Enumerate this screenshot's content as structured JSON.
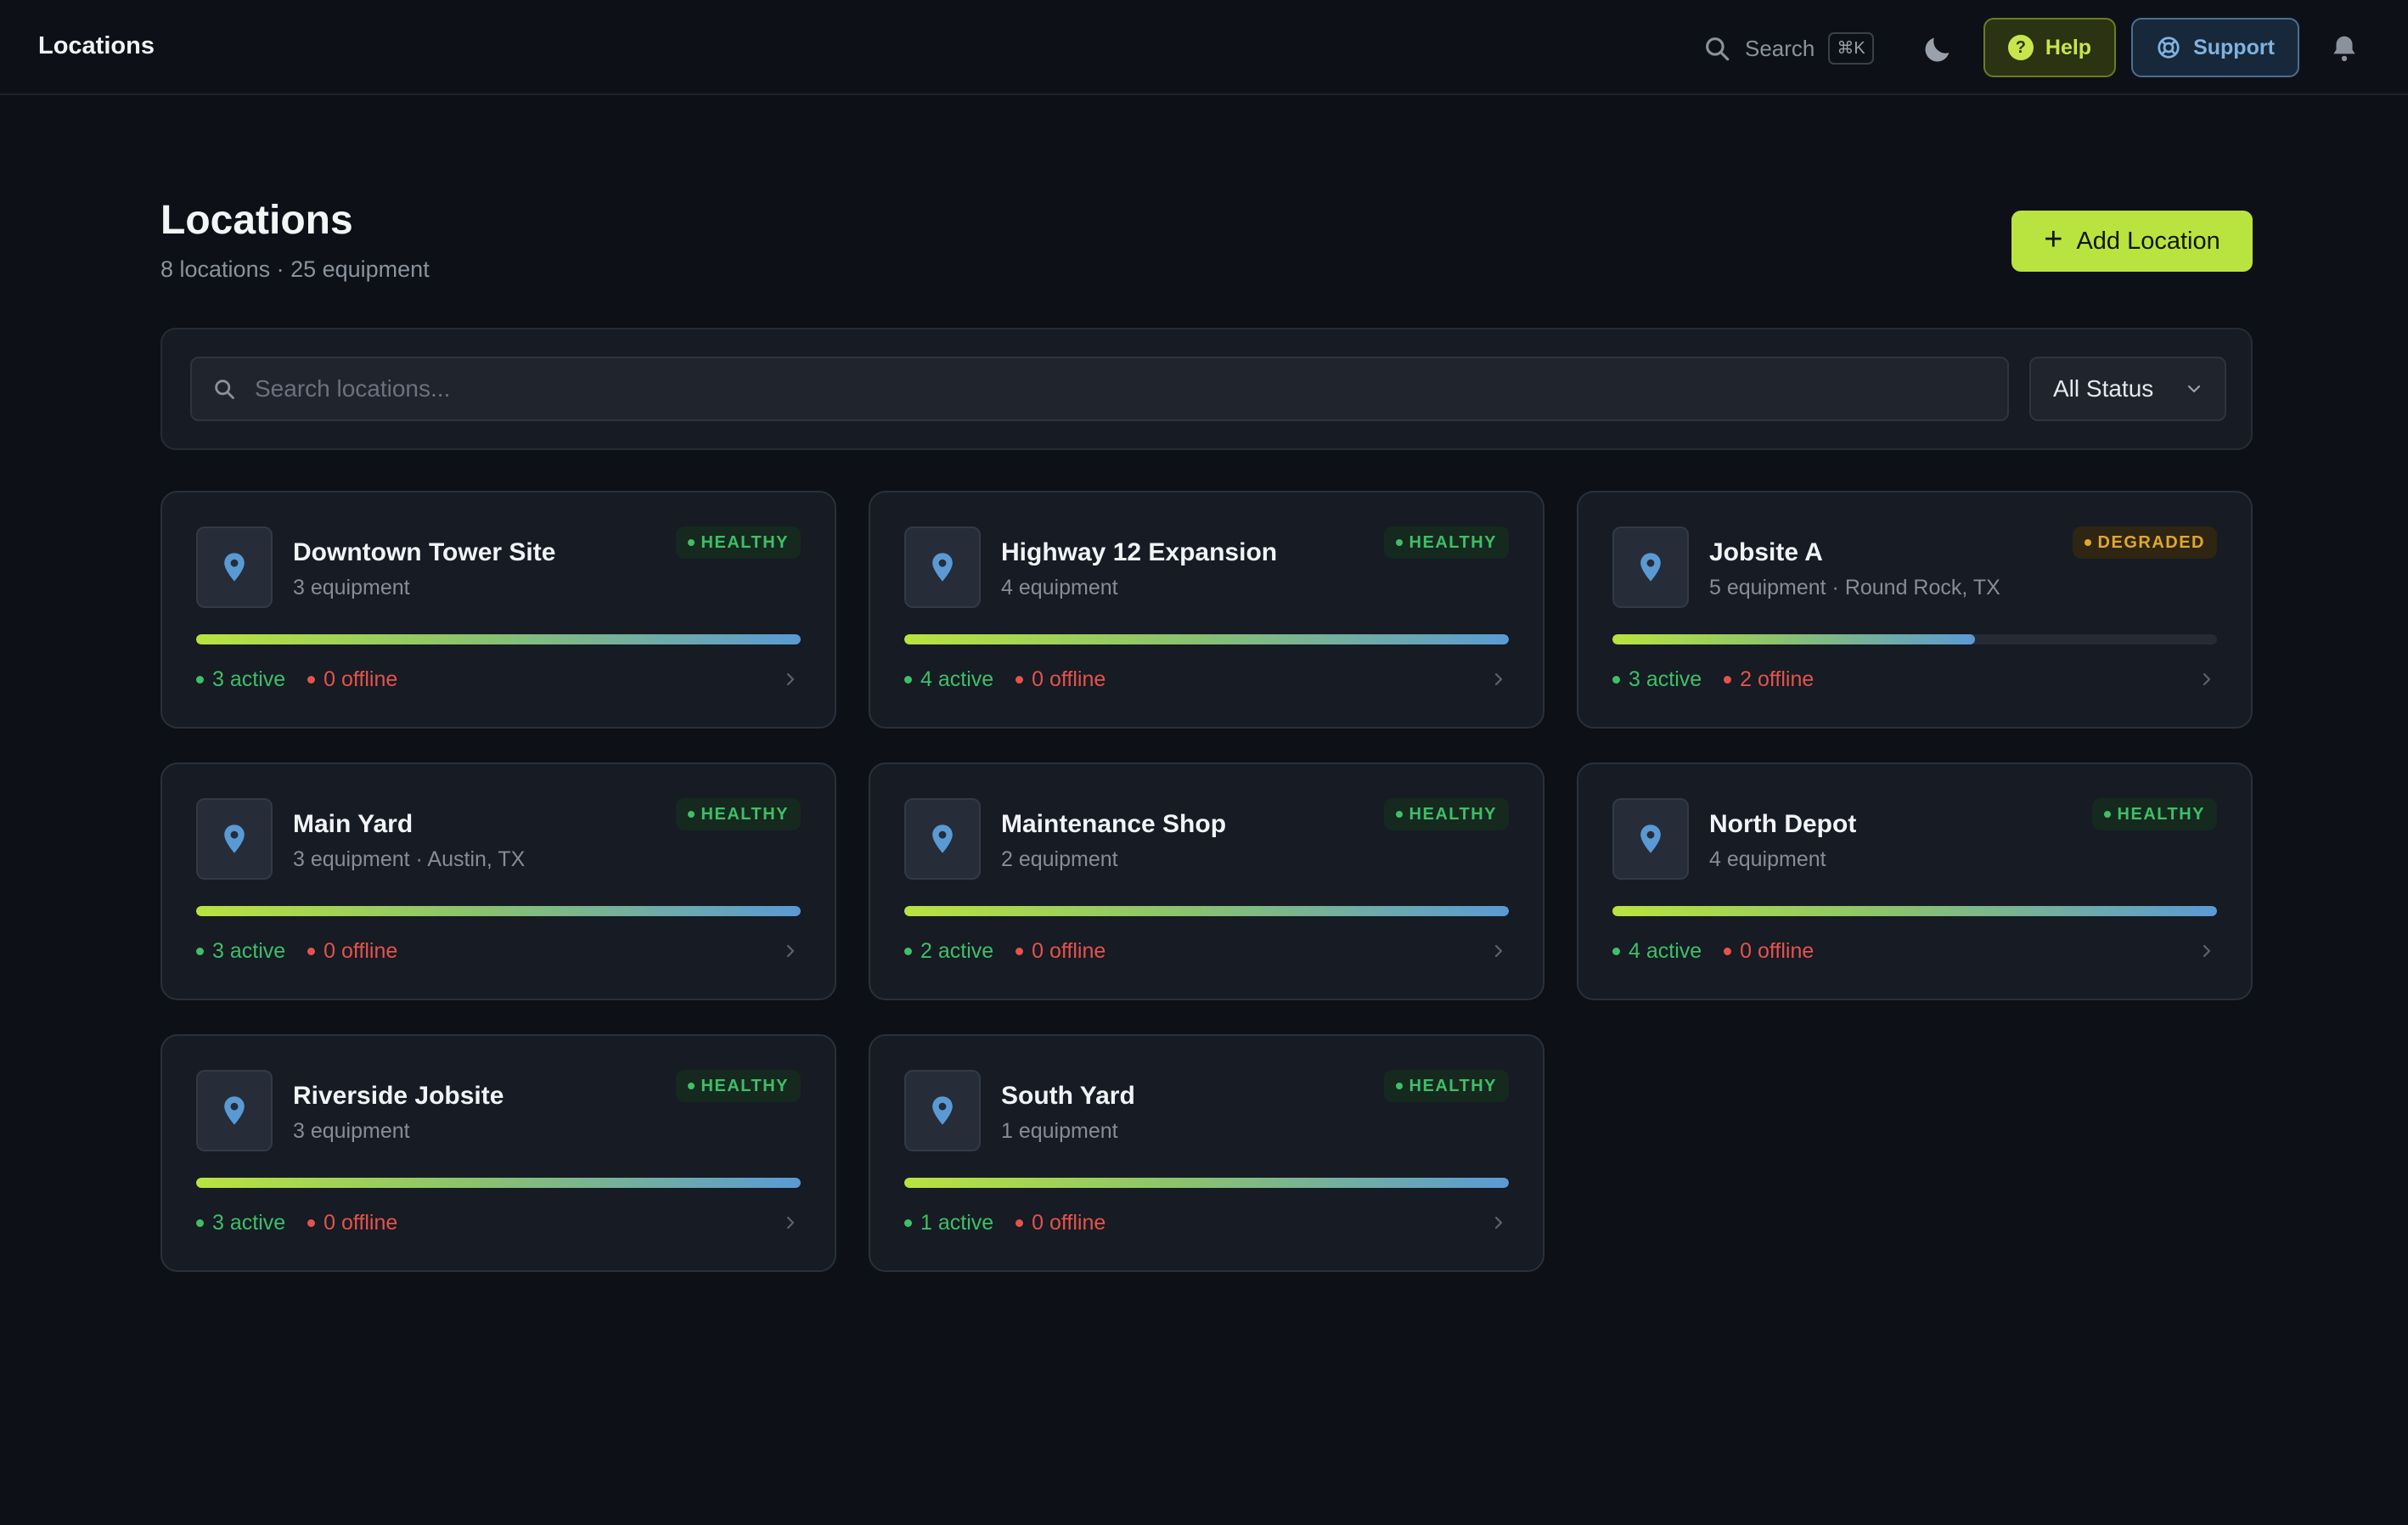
{
  "topbar": {
    "title": "Locations",
    "search_label": "Search",
    "search_shortcut": "⌘K",
    "help_label": "Help",
    "support_label": "Support"
  },
  "header": {
    "title": "Locations",
    "subtitle": "8 locations · 25 equipment",
    "add_button_label": "Add Location"
  },
  "filters": {
    "search_placeholder": "Search locations...",
    "status_value": "All Status"
  },
  "locations": [
    {
      "name": "Downtown Tower Site",
      "meta": "3 equipment",
      "status": "HEALTHY",
      "active": "3 active",
      "offline": "0 offline",
      "health": 1.0
    },
    {
      "name": "Highway 12 Expansion",
      "meta": "4 equipment",
      "status": "HEALTHY",
      "active": "4 active",
      "offline": "0 offline",
      "health": 1.0
    },
    {
      "name": "Jobsite A",
      "meta": "5 equipment · Round Rock, TX",
      "status": "DEGRADED",
      "active": "3 active",
      "offline": "2 offline",
      "health": 0.6
    },
    {
      "name": "Main Yard",
      "meta": "3 equipment · Austin, TX",
      "status": "HEALTHY",
      "active": "3 active",
      "offline": "0 offline",
      "health": 1.0
    },
    {
      "name": "Maintenance Shop",
      "meta": "2 equipment",
      "status": "HEALTHY",
      "active": "2 active",
      "offline": "0 offline",
      "health": 1.0
    },
    {
      "name": "North Depot",
      "meta": "4 equipment",
      "status": "HEALTHY",
      "active": "4 active",
      "offline": "0 offline",
      "health": 1.0
    },
    {
      "name": "Riverside Jobsite",
      "meta": "3 equipment",
      "status": "HEALTHY",
      "active": "3 active",
      "offline": "0 offline",
      "health": 1.0
    },
    {
      "name": "South Yard",
      "meta": "1 equipment",
      "status": "HEALTHY",
      "active": "1 active",
      "offline": "0 offline",
      "health": 1.0
    }
  ],
  "colors": {
    "accent": "#b9e33f",
    "healthy": "#3fbf66",
    "degraded": "#e0a72e",
    "offline": "#e5534b",
    "pin": "#5a9ad4"
  }
}
